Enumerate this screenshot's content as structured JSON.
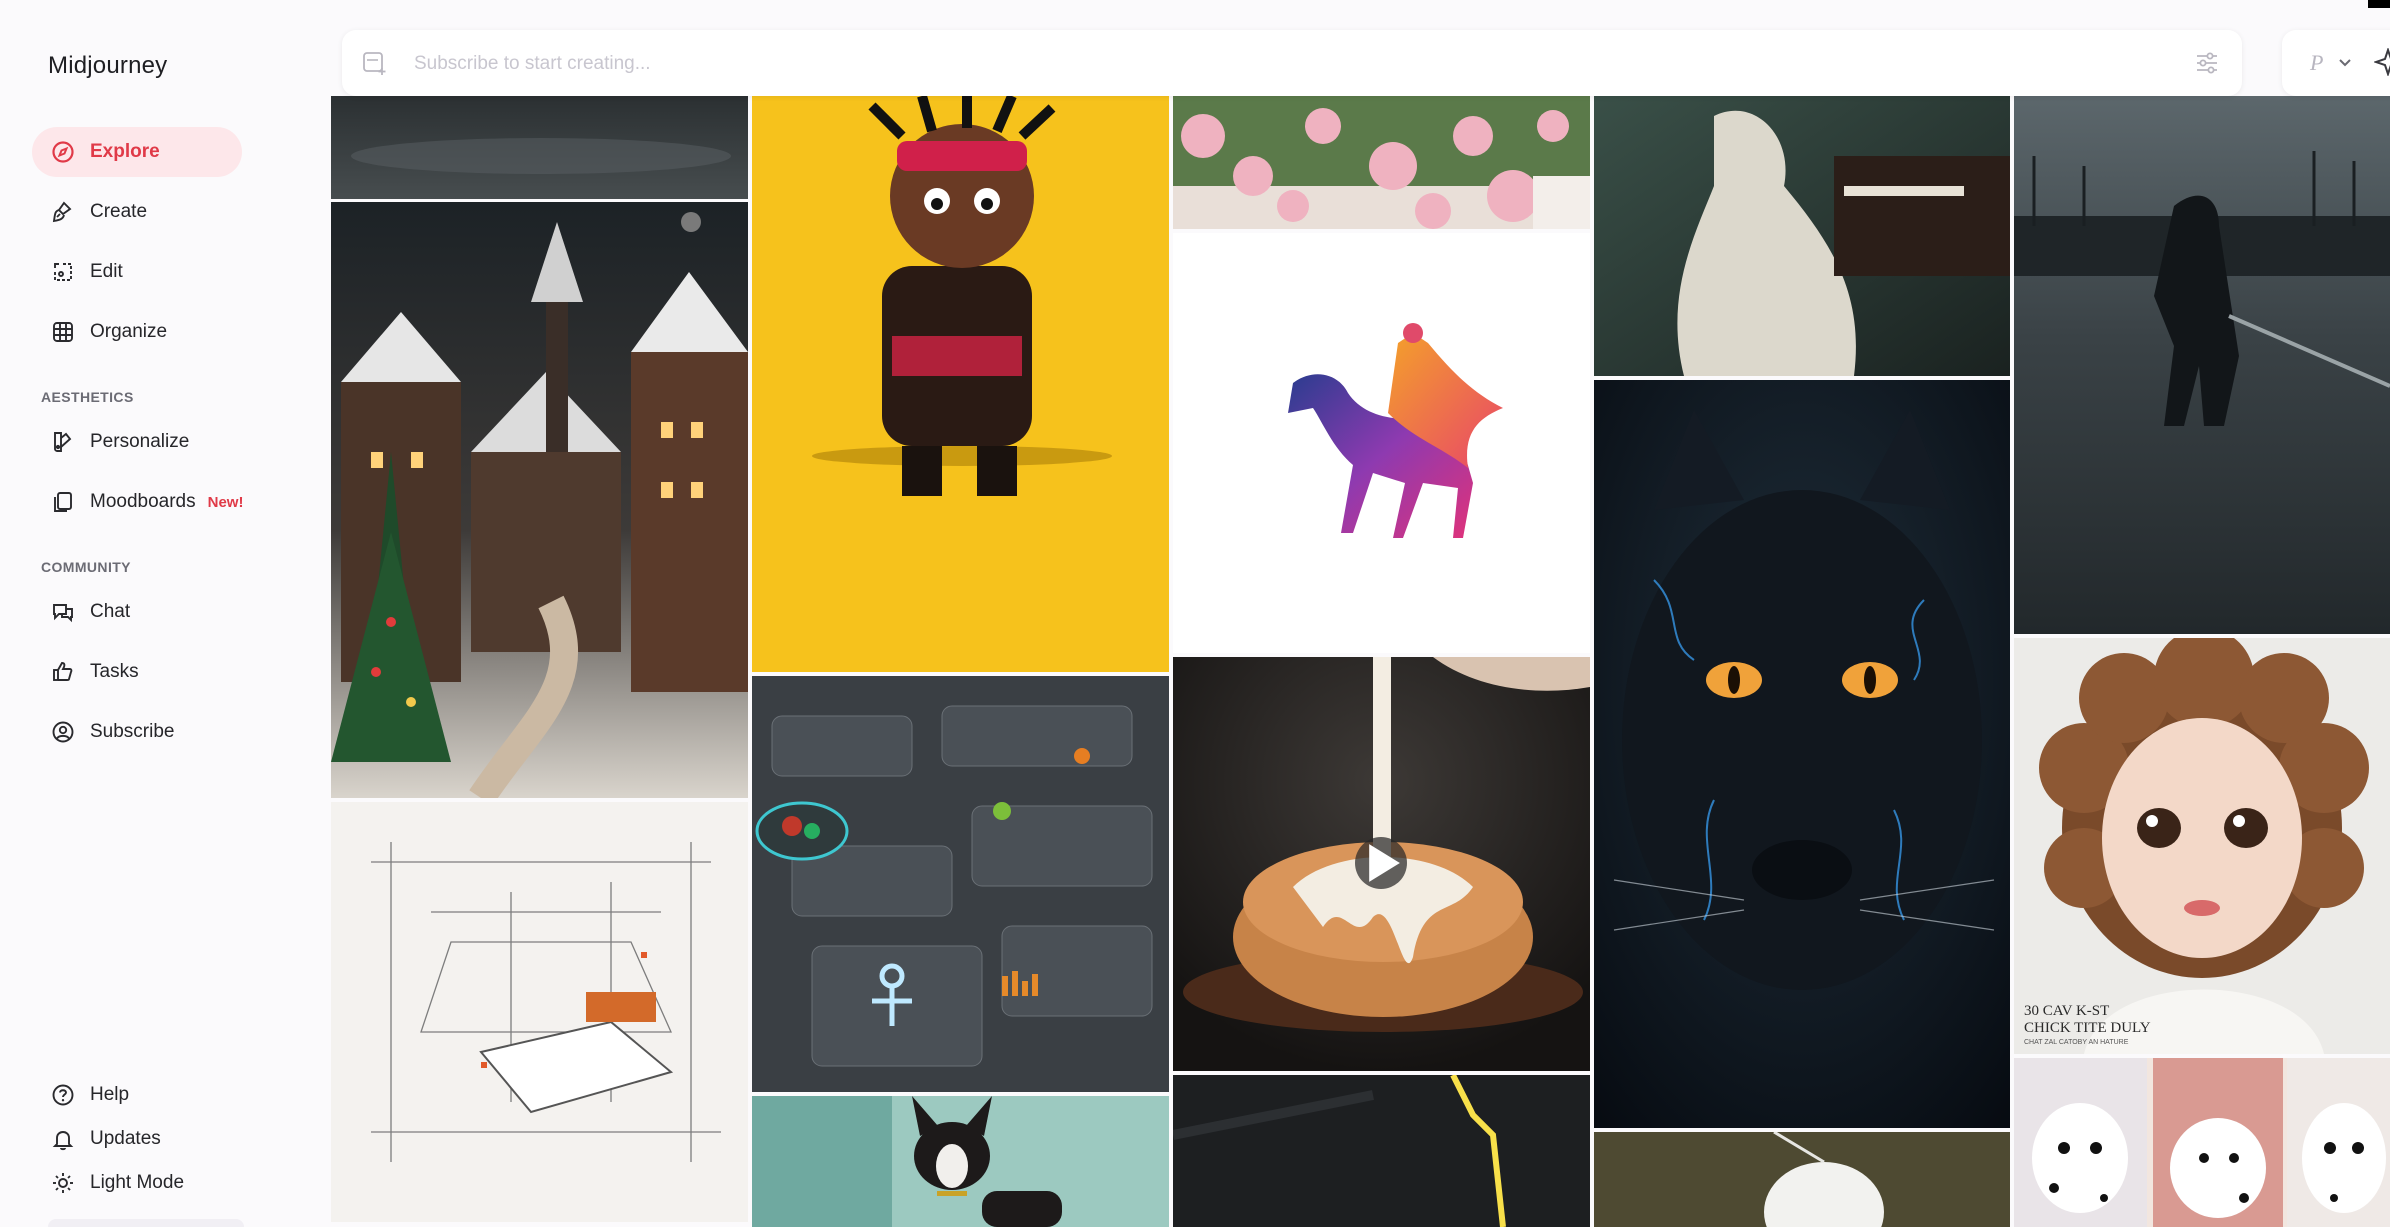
{
  "app": {
    "brand": "Midjourney"
  },
  "sidebar": {
    "main_items": [
      {
        "label": "Explore",
        "icon": "compass-icon",
        "active": true
      },
      {
        "label": "Create",
        "icon": "brush-icon"
      },
      {
        "label": "Edit",
        "icon": "edit-icon"
      },
      {
        "label": "Organize",
        "icon": "grid-icon"
      }
    ],
    "aesthetics_label": "AESTHETICS",
    "aesthetics_items": [
      {
        "label": "Personalize",
        "icon": "palette-icon"
      },
      {
        "label": "Moodboards",
        "icon": "moodboard-icon",
        "badge": "New!"
      }
    ],
    "community_label": "COMMUNITY",
    "community_items": [
      {
        "label": "Chat",
        "icon": "chat-icon"
      },
      {
        "label": "Tasks",
        "icon": "thumbs-up-icon"
      },
      {
        "label": "Subscribe",
        "icon": "user-circle-icon"
      }
    ],
    "bottom_items": [
      {
        "label": "Help",
        "icon": "help-icon"
      },
      {
        "label": "Updates",
        "icon": "bell-icon"
      },
      {
        "label": "Light Mode",
        "icon": "sun-icon"
      }
    ]
  },
  "search": {
    "placeholder": "Subscribe to start creating...",
    "value": "",
    "right_label": "P"
  },
  "gallery": {
    "tiles": [
      "dark-wet-street-image",
      "snowy-christmas-village-image",
      "architectural-sketch-bedroom-image",
      "cartoon-character-yellow-image",
      "dashboard-ui-image",
      "french-bulldog-image",
      "pink-roses-image",
      "horse-rider-logo-image",
      "cinnamon-roll-video",
      "neon-light-image",
      "pianist-painting-image",
      "black-panther-image",
      "white-feather-image",
      "warrior-battlefield-image",
      "curly-hair-doll-image",
      "dalmatian-puppies-image"
    ],
    "doll_caption": "30 CAV K-ST\nCHICK TITE DULY",
    "doll_subcaption": "CHAT ZAL CATOBY AN HATURE"
  },
  "colors": {
    "accent": "#e03a48",
    "active_bg": "#fde7ea",
    "sidebar_bg": "#fbfafc"
  }
}
